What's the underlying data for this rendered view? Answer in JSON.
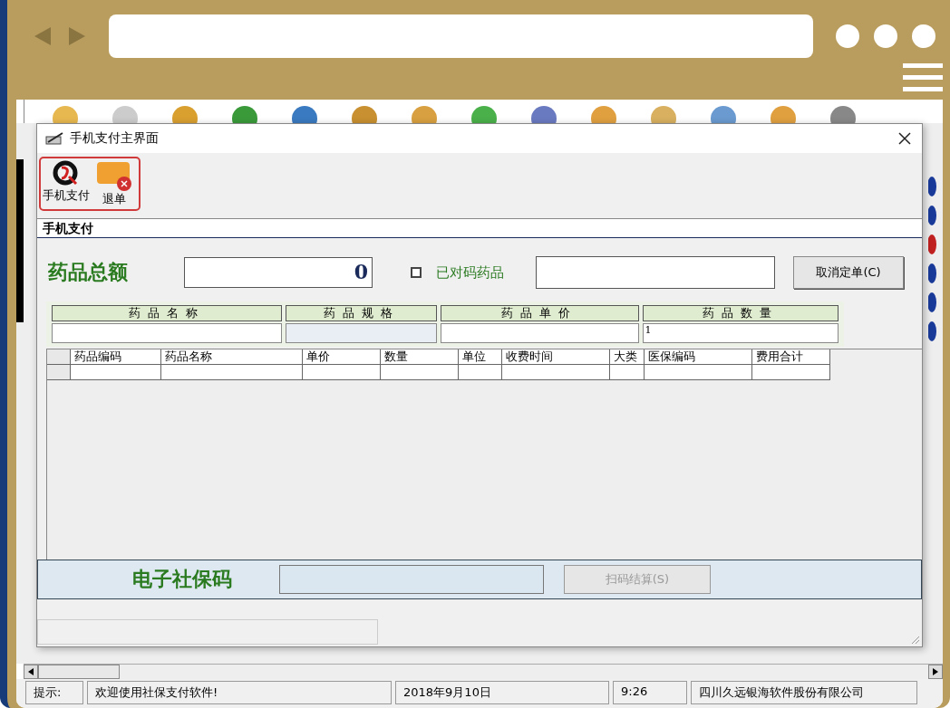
{
  "dialog": {
    "title": "手机支付主界面",
    "toolbar": [
      {
        "kind": "pay",
        "label": "手机支付"
      },
      {
        "kind": "refund",
        "label": "退单"
      }
    ],
    "section_title": "手机支付",
    "total": {
      "label": "药品总额",
      "value": "0"
    },
    "matched": {
      "label": "已对码药品",
      "checked": false
    },
    "cancel_button": "取消定单(C)",
    "fields": [
      {
        "label": "药品名称",
        "disabled": false
      },
      {
        "label": "药品规格",
        "disabled": true
      },
      {
        "label": "药品单价",
        "disabled": false
      },
      {
        "label": "药品数量",
        "disabled": false,
        "value": "1"
      }
    ],
    "table": {
      "columns": [
        "药品编码",
        "药品名称",
        "单价",
        "数量",
        "单位",
        "收费时间",
        "大类",
        "医保编码",
        "费用合计"
      ]
    },
    "scan": {
      "label": "电子社保码",
      "button": "扫码结算(S)",
      "disabled": true
    }
  },
  "status_bar": [
    "提示:",
    "欢迎使用社保支付软件!",
    "2018年9月10日",
    "9:26",
    "四川久远银海软件股份有限公司"
  ]
}
